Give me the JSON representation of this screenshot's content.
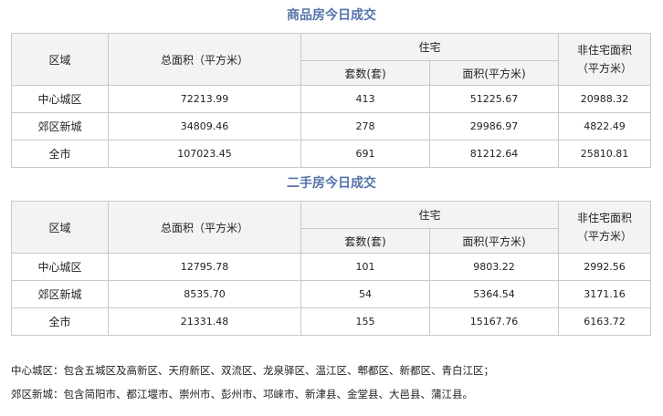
{
  "new_house": {
    "title": "商品房今日成交",
    "headers": {
      "region": "区域",
      "total_area": "总面积（平方米）",
      "residential": "住宅",
      "units": "套数(套)",
      "area": "面积(平方米)",
      "non_res_line1": "非住宅面积",
      "non_res_line2": "（平方米）"
    },
    "rows": [
      {
        "region": "中心城区",
        "total_area": "72213.99",
        "units": "413",
        "area": "51225.67",
        "non_res": "20988.32"
      },
      {
        "region": "郊区新城",
        "total_area": "34809.46",
        "units": "278",
        "area": "29986.97",
        "non_res": "4822.49"
      },
      {
        "region": "全市",
        "total_area": "107023.45",
        "units": "691",
        "area": "81212.64",
        "non_res": "25810.81"
      }
    ]
  },
  "second_hand": {
    "title": "二手房今日成交",
    "headers": {
      "region": "区域",
      "total_area": "总面积（平方米）",
      "residential": "住宅",
      "units": "套数(套)",
      "area": "面积(平方米)",
      "non_res_line1": "非住宅面积",
      "non_res_line2": "（平方米）"
    },
    "rows": [
      {
        "region": "中心城区",
        "total_area": "12795.78",
        "units": "101",
        "area": "9803.22",
        "non_res": "2992.56"
      },
      {
        "region": "郊区新城",
        "total_area": "8535.70",
        "units": "54",
        "area": "5364.54",
        "non_res": "3171.16"
      },
      {
        "region": "全市",
        "total_area": "21331.48",
        "units": "155",
        "area": "15167.76",
        "non_res": "6163.72"
      }
    ]
  },
  "notes": {
    "center": "中心城区：包含五城区及高新区、天府新区、双流区、龙泉驿区、温江区、郫都区、新都区、青白江区；",
    "suburb": "郊区新城：包含简阳市、都江堰市、崇州市、彭州市、邛崃市、新津县、金堂县、大邑县、蒲江县。"
  }
}
